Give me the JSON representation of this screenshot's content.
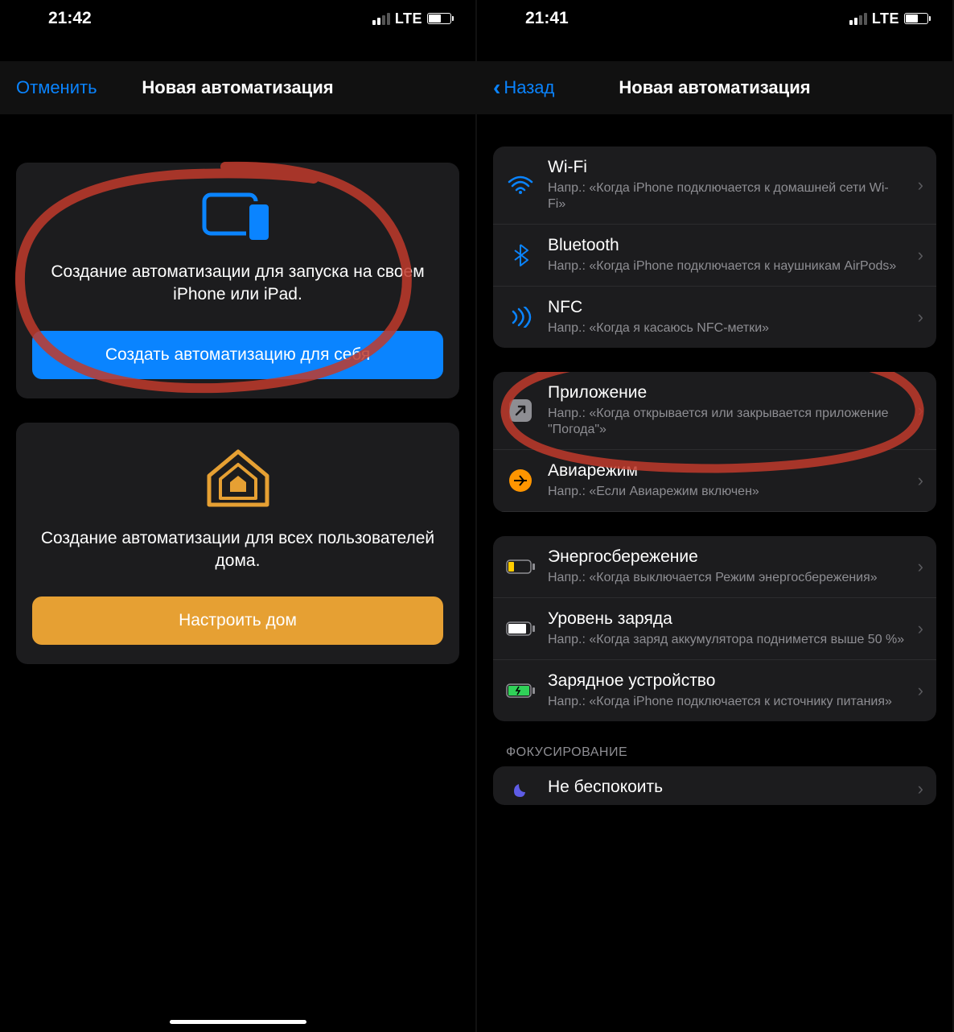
{
  "left": {
    "status_time": "21:42",
    "lte": "LTE",
    "nav_cancel": "Отменить",
    "nav_title": "Новая автоматизация",
    "personal": {
      "desc": "Создание автоматизации для запуска на своем iPhone или iPad.",
      "button": "Создать автоматизацию для себя"
    },
    "home": {
      "desc": "Создание автоматизации для всех пользователей дома.",
      "button": "Настроить дом"
    }
  },
  "right": {
    "status_time": "21:41",
    "lte": "LTE",
    "nav_back": "Назад",
    "nav_title": "Новая автоматизация",
    "group1": [
      {
        "title": "Wi-Fi",
        "sub": "Напр.: «Когда iPhone подключается к домашней сети Wi-Fi»"
      },
      {
        "title": "Bluetooth",
        "sub": "Напр.: «Когда iPhone подключается к наушникам AirPods»"
      },
      {
        "title": "NFC",
        "sub": "Напр.: «Когда я касаюсь NFC-метки»"
      }
    ],
    "group2": [
      {
        "title": "Приложение",
        "sub": "Напр.: «Когда открывается или закрывается приложение \"Погода\"»"
      },
      {
        "title": "Авиарежим",
        "sub": "Напр.: «Если Авиарежим включен»"
      }
    ],
    "group3": [
      {
        "title": "Энергосбережение",
        "sub": "Напр.: «Когда выключается Режим энергосбережения»"
      },
      {
        "title": "Уровень заряда",
        "sub": "Напр.: «Когда заряд аккумулятора поднимется выше 50 %»"
      },
      {
        "title": "Зарядное устройство",
        "sub": "Напр.: «Когда iPhone подключается к источнику питания»"
      }
    ],
    "section_focus": "ФОКУСИРОВАНИЕ",
    "group4": [
      {
        "title": "Не беспокоить",
        "sub": ""
      }
    ]
  },
  "colors": {
    "accent": "#0a84ff",
    "orange": "#e6a033"
  }
}
